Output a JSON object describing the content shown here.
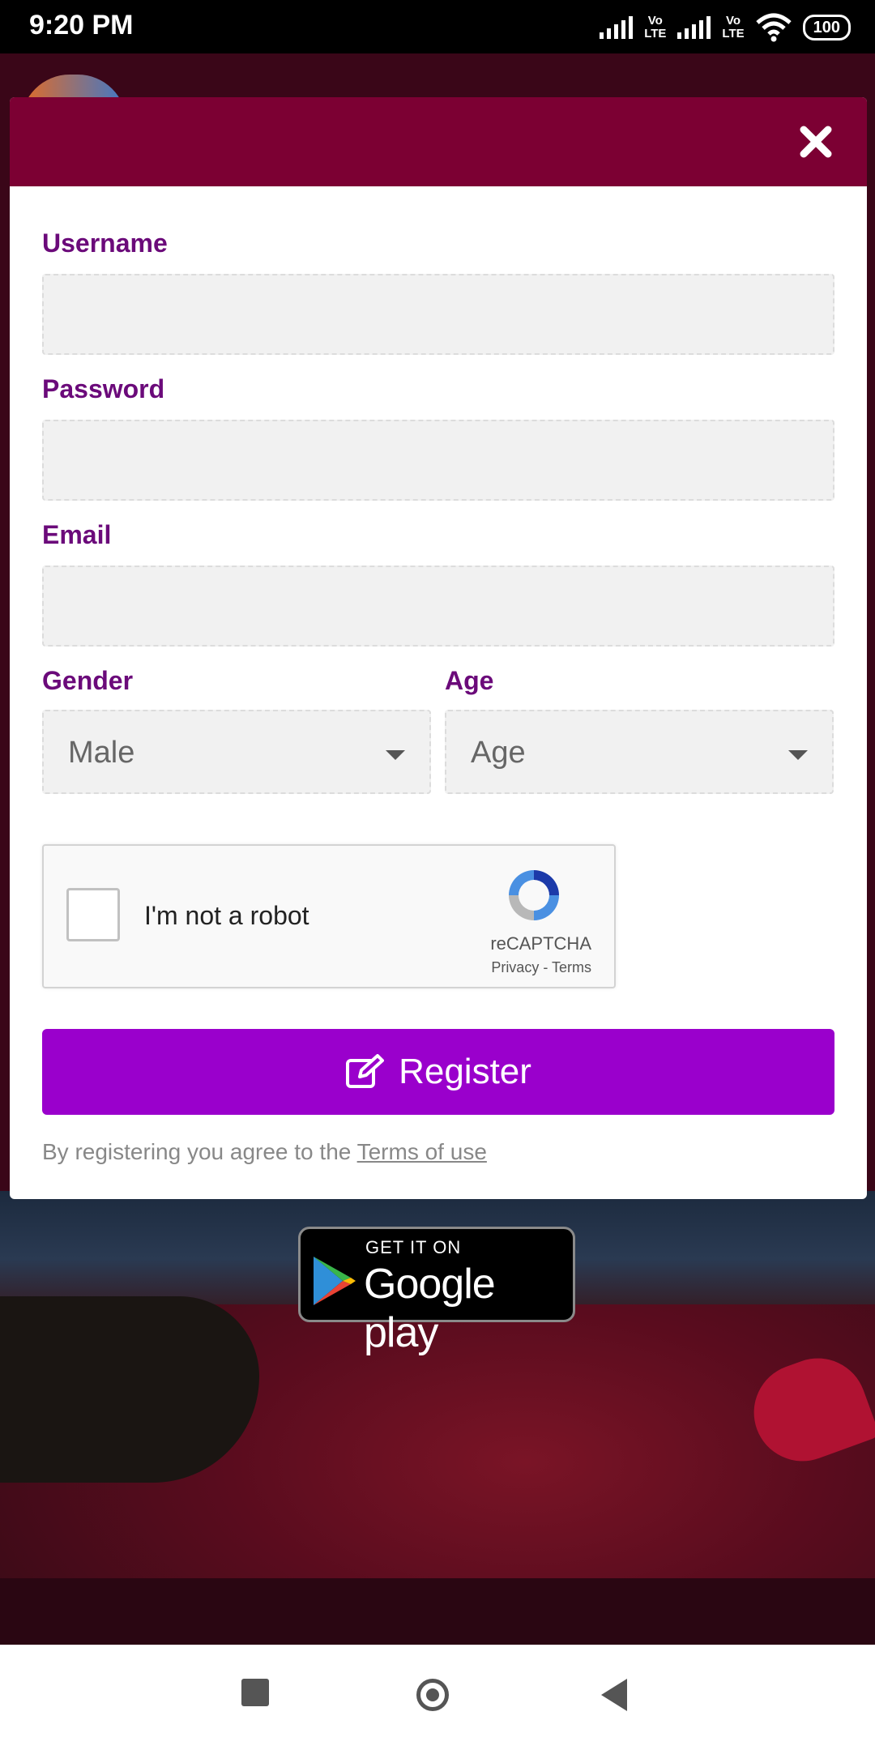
{
  "status_bar": {
    "time": "9:20 PM",
    "network_label_1": "Vo\nLTE",
    "network_label_2": "Vo\nLTE",
    "battery": "100"
  },
  "background": {
    "google_play_small": "GET IT ON",
    "google_play_big": "Google play"
  },
  "modal": {
    "close_icon": "close-icon",
    "username_label": "Username",
    "username_value": "",
    "password_label": "Password",
    "password_value": "",
    "email_label": "Email",
    "email_value": "",
    "gender_label": "Gender",
    "gender_value": "Male",
    "age_label": "Age",
    "age_value": "Age",
    "captcha_text": "I'm not a robot",
    "captcha_brand": "reCAPTCHA",
    "captcha_links": "Privacy - Terms",
    "register_label": "Register",
    "terms_prefix": "By registering you agree to the ",
    "terms_link": "Terms of use",
    "colors": {
      "header": "#7c0033",
      "label": "#6b0a7a",
      "register_button": "#9a00cc"
    }
  }
}
